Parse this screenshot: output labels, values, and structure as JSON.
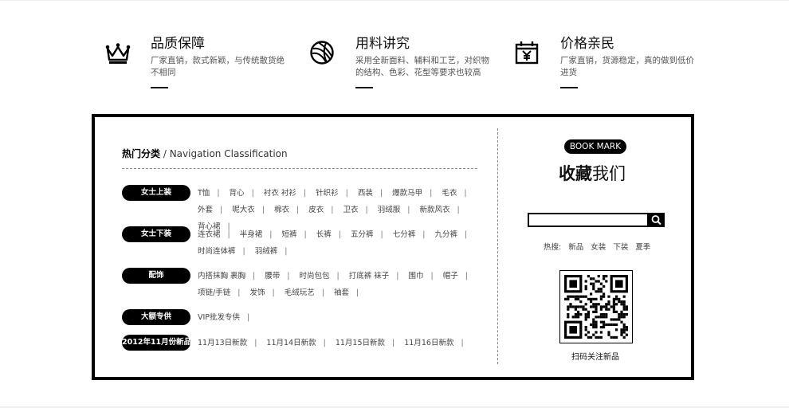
{
  "features": [
    {
      "title": "品质保障",
      "desc": "厂家直销，款式新颖，与传统散货绝不相同",
      "icon": "crown-icon"
    },
    {
      "title": "用料讲究",
      "desc": "采用全新面料、辅料和工艺，对织物的结构、色彩、花型等要求也较高",
      "icon": "yarn-ball-icon"
    },
    {
      "title": "价格亲民",
      "desc": "厂家直销，货源稳定，真的做到低价进货",
      "icon": "price-calendar-icon"
    }
  ],
  "nav": {
    "title_bold": "热门分类",
    "title_rest": " / Navigation Classification"
  },
  "categories": [
    {
      "label": "女士上装",
      "items": [
        "T恤",
        "背心",
        "衬衣 衬衫",
        "针织衫",
        "西装",
        "爆款马甲",
        "毛衣",
        "外套",
        "呢大衣",
        "棉衣",
        "皮衣",
        "卫衣",
        "羽绒服",
        "新款风衣",
        "背心裙"
      ]
    },
    {
      "label": "女士下装",
      "items": [
        "连衣裙",
        "半身裙",
        "短裤",
        "长裤",
        "五分裤",
        "七分裤",
        "九分裤",
        "时尚连体裤",
        "羽绒裤"
      ]
    },
    {
      "label": "配饰",
      "items": [
        "内搭抹胸 裹胸",
        "腰带",
        "时尚包包",
        "打底裤 袜子",
        "围巾",
        "帽子",
        "项链/手链",
        "发饰",
        "毛绒玩艺",
        "袖套"
      ]
    },
    {
      "label": "大额专供",
      "items": [
        "VIP批发专供"
      ]
    },
    {
      "label": "2012年11月份新品",
      "items": [
        "11月13日新款",
        "11月14日新款",
        "11月15日新款",
        "11月16日新款"
      ]
    }
  ],
  "bookmark": {
    "badge": "BOOK MARK",
    "title_bold": "收藏",
    "title_rest": "我们",
    "search_placeholder": "",
    "hot_label": "热搜:",
    "hot_items": [
      "新品",
      "女装",
      "下装",
      "夏季"
    ],
    "qr_label": "扫码关注新品"
  }
}
